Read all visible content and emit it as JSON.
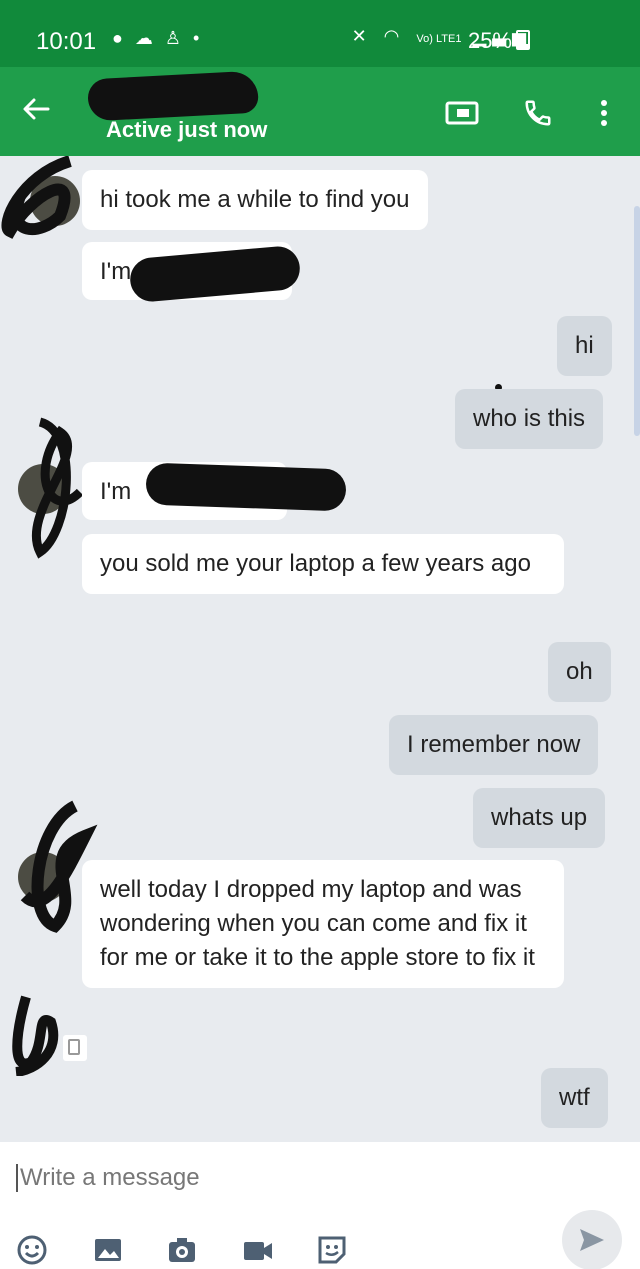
{
  "status_bar": {
    "time": "10:01",
    "left_icons": [
      "chat-bubble-icon",
      "weather-icon",
      "accessibility-icon",
      "dot-icon"
    ],
    "network_label": "Vo) LTE1",
    "battery": "25%",
    "battery_level": 0.25
  },
  "header": {
    "subtitle": "Active just now",
    "actions": [
      "video-call-icon",
      "phone-icon",
      "more-options-icon"
    ],
    "accent": "#1f9e4b"
  },
  "messages": [
    {
      "dir": "in",
      "text": "hi took me a while to find you"
    },
    {
      "dir": "in",
      "text": "I'm"
    },
    {
      "dir": "out",
      "text": "hi"
    },
    {
      "dir": "out",
      "text": "who is this"
    },
    {
      "dir": "in",
      "text": "I'm"
    },
    {
      "dir": "in",
      "text": "you sold me your laptop a few years ago"
    },
    {
      "dir": "out",
      "text": "oh"
    },
    {
      "dir": "out",
      "text": "I remember now"
    },
    {
      "dir": "out",
      "text": "whats up"
    },
    {
      "dir": "in",
      "text": "well today I dropped my laptop and was wondering when you can come and fix it for me or take it to the apple store to fix it"
    },
    {
      "dir": "out",
      "text": "wtf"
    }
  ],
  "composer": {
    "placeholder": "Write a message",
    "tools": [
      "emoji-icon",
      "image-icon",
      "camera-icon",
      "video-icon",
      "sticker-icon"
    ],
    "send": "send-icon"
  }
}
